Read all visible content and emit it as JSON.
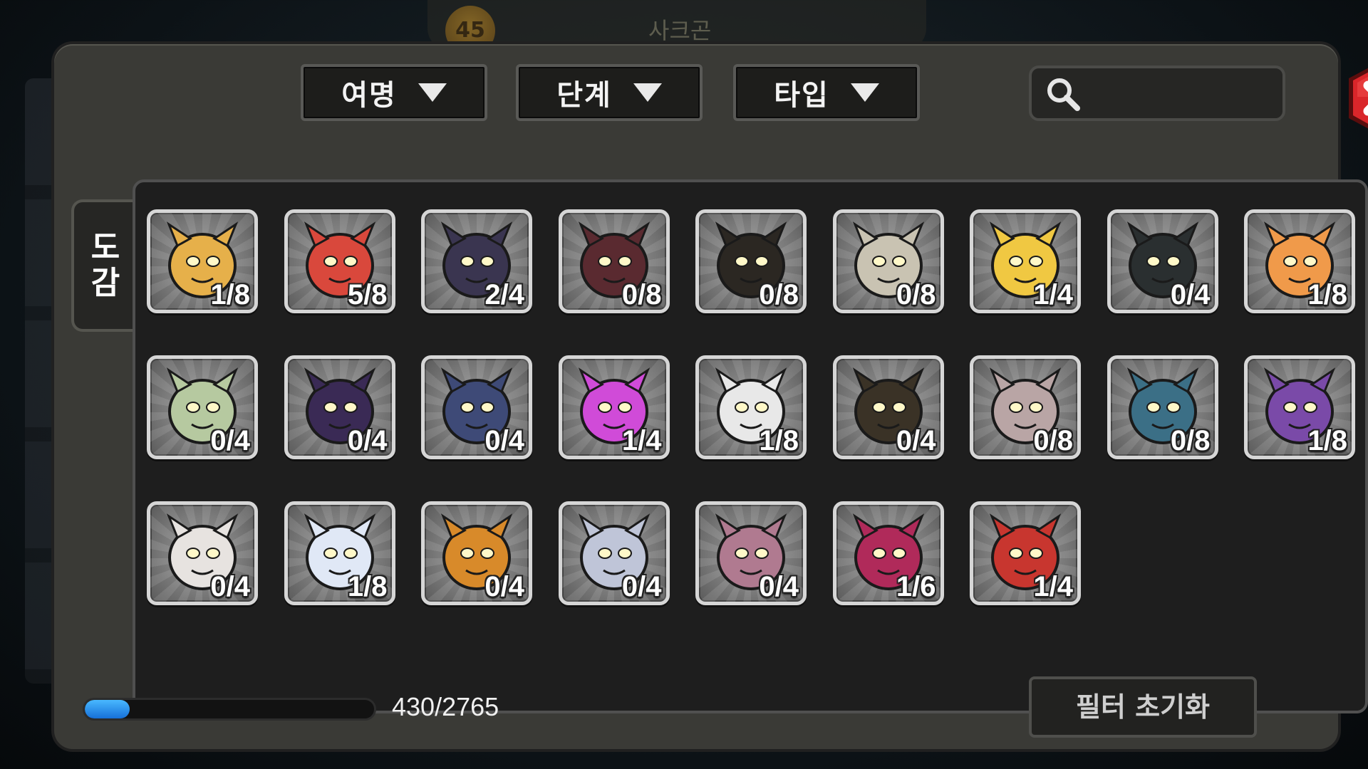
{
  "background": {
    "level": "45",
    "player_name": "사크곤"
  },
  "filters": {
    "grade_label": "여명",
    "stage_label": "단계",
    "type_label": "타입"
  },
  "search": {
    "placeholder": "",
    "icon": "search-icon"
  },
  "tab": {
    "line1": "도",
    "line2": "감"
  },
  "collection": [
    {
      "count": "1/8",
      "color": "#e6b04a"
    },
    {
      "count": "5/8",
      "color": "#d9483c"
    },
    {
      "count": "2/4",
      "color": "#3a3550"
    },
    {
      "count": "0/8",
      "color": "#5a2a30"
    },
    {
      "count": "0/8",
      "color": "#2b2722"
    },
    {
      "count": "0/8",
      "color": "#c9c3b2"
    },
    {
      "count": "1/4",
      "color": "#f0c842"
    },
    {
      "count": "0/4",
      "color": "#2a2f30"
    },
    {
      "count": "1/8",
      "color": "#f09a4a"
    },
    {
      "count": "0/4",
      "color": "#b6c9a0"
    },
    {
      "count": "0/4",
      "color": "#3a2a55"
    },
    {
      "count": "0/4",
      "color": "#3e4a77"
    },
    {
      "count": "1/4",
      "color": "#d04bd8"
    },
    {
      "count": "1/8",
      "color": "#e8e8e8"
    },
    {
      "count": "0/4",
      "color": "#3a3226"
    },
    {
      "count": "0/8",
      "color": "#b9a5a5"
    },
    {
      "count": "0/8",
      "color": "#3b6f86"
    },
    {
      "count": "1/8",
      "color": "#7a4aa8"
    },
    {
      "count": "0/4",
      "color": "#e7e3e0"
    },
    {
      "count": "1/8",
      "color": "#e0e8f6"
    },
    {
      "count": "0/4",
      "color": "#d88a2a"
    },
    {
      "count": "0/4",
      "color": "#bfc5d8"
    },
    {
      "count": "0/4",
      "color": "#b07a90"
    },
    {
      "count": "1/6",
      "color": "#b02a5a"
    },
    {
      "count": "1/4",
      "color": "#c8362f"
    }
  ],
  "progress": {
    "text": "430/2765",
    "fraction": 0.155
  },
  "reset_button": {
    "label": "필터 초기화"
  },
  "accent": {
    "close": "#d9262a",
    "progress": "#2a8cf0"
  }
}
